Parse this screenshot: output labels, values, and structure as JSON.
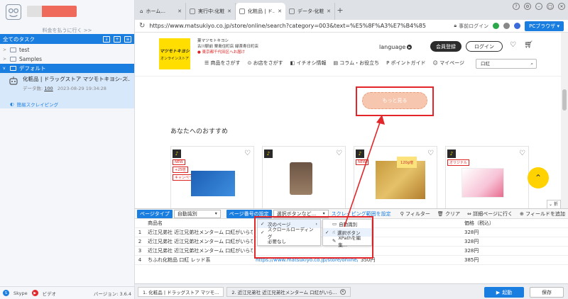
{
  "sidebar": {
    "notice": "料金を払うに行く >>",
    "task_header": "全てのタスク",
    "tree": [
      {
        "label": "test",
        "active": false
      },
      {
        "label": "Samples",
        "active": false
      },
      {
        "label": "デフォルト",
        "active": true
      }
    ],
    "task": {
      "title": "化粧品 | ドラッグストア マツモトキヨシ-ス...",
      "data_label": "データ数:",
      "data_count": "100",
      "date": "2023-08-29 19:34:28",
      "quick_label": "簡易スクレイピング"
    },
    "footer": {
      "skype": "Skype",
      "video": "ビデオ",
      "version": "バージョン: 3.6.4"
    }
  },
  "browser": {
    "tabs": [
      {
        "label": "ホーム..."
      },
      {
        "label": "実行中:化粧..."
      },
      {
        "label": "化粧品 | ド..."
      },
      {
        "label": "データ-化粧..."
      }
    ],
    "url": "https://www.matsukiyo.co.jp/store/online/search?category=003&text=%E5%8F%A3%E7%B4%85",
    "pre_login": "事前ログイン",
    "pc_browser": "PCブラウザ"
  },
  "site": {
    "logo_line1": "マツモトキヨシ",
    "logo_line2": "オンラインストア",
    "store_name": "薬マツモトキヨシ",
    "store_line2": "古川駅前 栗島住町店 緑茶寿日町店",
    "store_change": "東京都千代田区へお届け",
    "language": "language",
    "register": "会員登録",
    "login": "ログイン",
    "nav": [
      "商品をさがす",
      "お店をさがす",
      "イチオシ情報",
      "コラム・お役立ち",
      "ポイントガイド",
      "マイページ"
    ],
    "search_value": "口紅",
    "more_button": "もっと見る",
    "recommend_title": "あなたへのおすすめ",
    "product_tags_1": [
      "NEW",
      "+25倍",
      "キャンペーン"
    ],
    "product_tag_3": "120g増",
    "product_tag_3b": "NEW",
    "product_tag_4": "オリジナル",
    "fold": "折る"
  },
  "panel": {
    "page_type_label": "ページタイプ",
    "page_type_value": "自動識別",
    "page_no_label": "ページ番号の設定",
    "select_value": "選択ボタンなど...",
    "scrape_range": "スクレイピング範囲を設定",
    "filter": "フィルター",
    "clear": "クリア",
    "detail": "詳細ページに行く",
    "add_field": "フィールドを追加",
    "columns": [
      "商品名",
      "",
      "本体)",
      "価格（税込）"
    ],
    "rows": [
      {
        "n": "1",
        "name": "近江兄弟社 近江兄弟社メンターム 口紅がいらな...",
        "url": "",
        "body": "",
        "price": "328円"
      },
      {
        "n": "2",
        "name": "近江兄弟社 近江兄弟社メンターム 口紅がいらな...",
        "url": "",
        "body": "",
        "price": "328円"
      },
      {
        "n": "3",
        "name": "近江兄弟社 近江兄弟社メンターム 口紅がいらな...",
        "url": "",
        "body": "",
        "price": "328円"
      },
      {
        "n": "4",
        "name": "ちふれ化粧品 口紅 レッド系",
        "url": "https://www.matsukiyo.co.jp/store/online/p/4974...",
        "body": "350円",
        "price": "385円"
      }
    ],
    "menu1": [
      "次のページ",
      "スクロールローディング",
      "必要なし"
    ],
    "menu2": [
      "自動識別",
      "選択ボタン",
      "XPathを編集..."
    ]
  },
  "bottom": {
    "tabs": [
      "1. 化粧品 | ドラッグストア マツモ...",
      "2. 近江兄弟社 近江兄弟社メンターム 口紅がいら..."
    ],
    "start": "起動",
    "save": "保存"
  }
}
